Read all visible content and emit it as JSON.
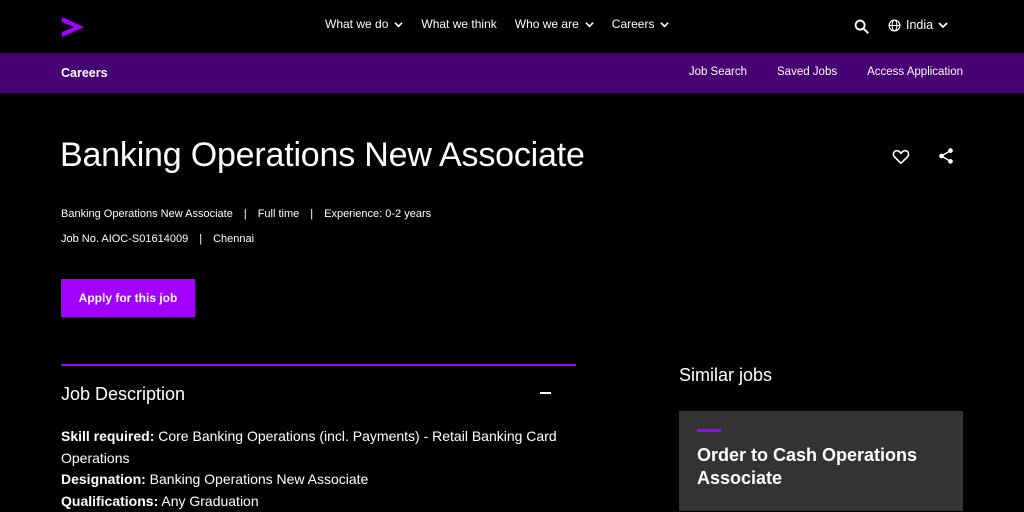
{
  "topnav": {
    "items": [
      {
        "label": "What we do",
        "has_dropdown": true
      },
      {
        "label": "What we think",
        "has_dropdown": false
      },
      {
        "label": "Who we are",
        "has_dropdown": true
      },
      {
        "label": "Careers",
        "has_dropdown": true
      }
    ],
    "search_icon": "search-icon",
    "locale": "India"
  },
  "subnav": {
    "title": "Careers",
    "links": [
      "Job Search",
      "Saved Jobs",
      "Access Application"
    ]
  },
  "job": {
    "title": "Banking Operations New Associate",
    "meta_line1": [
      "Banking Operations New Associate",
      "Full time",
      "Experience: 0-2 years"
    ],
    "meta_line2": [
      "Job No. AIOC-S01614009",
      "Chennai"
    ],
    "apply_label": "Apply for this job"
  },
  "description": {
    "header": "Job Description",
    "skill_label": "Skill required:",
    "skill_value": " Core Banking Operations (incl. Payments) - Retail Banking Card Operations",
    "designation_label": "Designation:",
    "designation_value": " Banking Operations New Associate",
    "qualification_label": "Qualifications:",
    "qualification_value": " Any Graduation"
  },
  "similar": {
    "title": "Similar jobs",
    "cards": [
      {
        "title": "Order to Cash Operations Associate"
      }
    ]
  },
  "colors": {
    "accent": "#a100ff",
    "subnav_bg": "#460073",
    "card_bg": "#333333"
  }
}
